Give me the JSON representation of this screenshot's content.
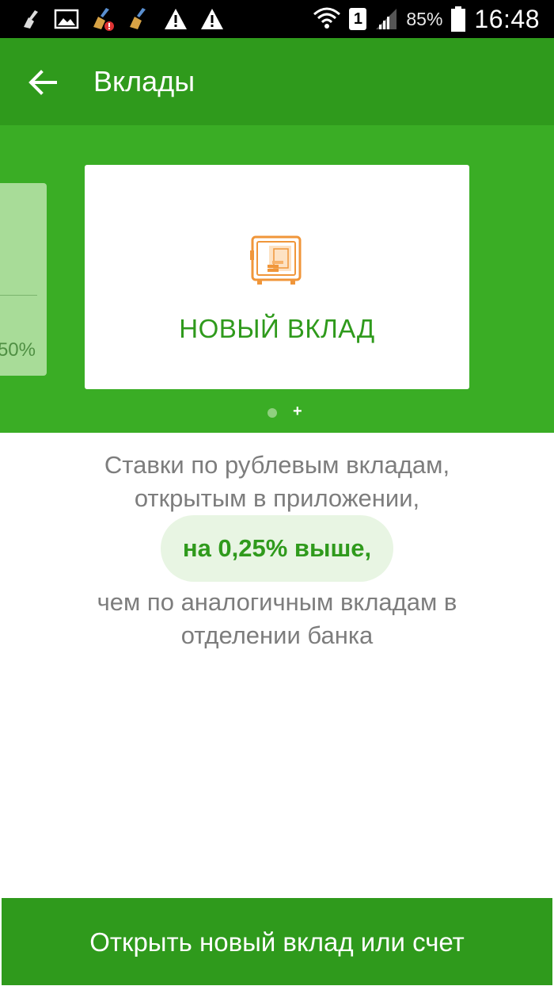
{
  "status_bar": {
    "left_icons": [
      "broom-icon",
      "image-icon",
      "broom-alert-icon",
      "broom-icon",
      "warning-icon",
      "warning-icon"
    ],
    "sim_label": "1",
    "battery_text": "85%",
    "time": "16:48"
  },
  "app_bar": {
    "title": "Вклады"
  },
  "carousel": {
    "prev_card_value": "50%",
    "main_card_label": "НОВЫЙ ВКЛАД",
    "pager_plus": "+"
  },
  "promo": {
    "line1": "Ставки по рублевым вкладам,",
    "line2": "открытым в приложении,",
    "highlight": "на 0,25% выше,",
    "line3": "чем по аналогичным вкладам в",
    "line4": "отделении банка"
  },
  "cta": {
    "label": "Открыть новый вклад или счет"
  },
  "colors": {
    "app_bar": "#2f9a1c",
    "carousel_bg": "#3aad25",
    "accent_orange": "#f0963a",
    "text_gray": "#7d7d7d",
    "highlight_bg": "#e8f5e3"
  }
}
